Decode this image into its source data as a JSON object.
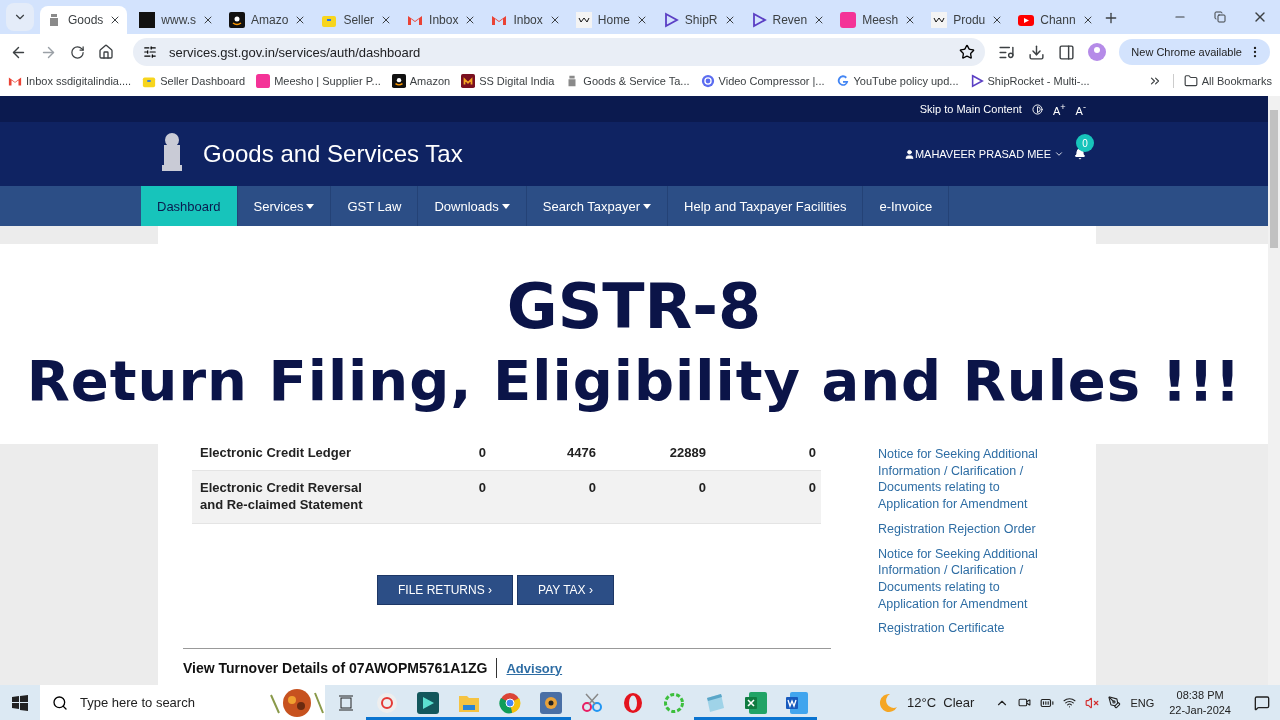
{
  "browser": {
    "tabs": [
      {
        "title": "Goods",
        "kind": "emblem",
        "selected": true
      },
      {
        "title": "www.s",
        "kind": "ss",
        "selected": false
      },
      {
        "title": "Amazo",
        "kind": "amazon",
        "selected": false
      },
      {
        "title": "Seller",
        "kind": "flipkart",
        "selected": false
      },
      {
        "title": "Inbox",
        "kind": "gmail",
        "selected": false
      },
      {
        "title": "Inbox",
        "kind": "gmail",
        "selected": false
      },
      {
        "title": "Home",
        "kind": "wix",
        "selected": false
      },
      {
        "title": "ShipR",
        "kind": "shiprocket",
        "selected": false
      },
      {
        "title": "Reven",
        "kind": "shiprocket",
        "selected": false
      },
      {
        "title": "Meesh",
        "kind": "meesho",
        "selected": false
      },
      {
        "title": "Produ",
        "kind": "wix",
        "selected": false
      },
      {
        "title": "Chann",
        "kind": "youtube",
        "selected": false
      }
    ],
    "url": "services.gst.gov.in/services/auth/dashboard",
    "update_button": "New Chrome available",
    "bookmarks": [
      {
        "title": "Inbox ssdigitalindia....",
        "kind": "gmail"
      },
      {
        "title": "Seller Dashboard",
        "kind": "flipkart"
      },
      {
        "title": "Meesho | Supplier P...",
        "kind": "meesho"
      },
      {
        "title": "Amazon",
        "kind": "amazon"
      },
      {
        "title": "SS Digital India",
        "kind": "ssd"
      },
      {
        "title": "Goods & Service Ta...",
        "kind": "emblem"
      },
      {
        "title": "Video Compressor |...",
        "kind": "compress"
      },
      {
        "title": "YouTube policy upd...",
        "kind": "google"
      },
      {
        "title": "ShipRocket - Multi-...",
        "kind": "shiprocket"
      }
    ],
    "all_bookmarks": "All Bookmarks"
  },
  "site": {
    "skip_link": "Skip to Main Content",
    "font_up": "A",
    "font_up_sign": "+",
    "font_down": "A",
    "font_down_sign": "-",
    "title": "Goods and Services Tax",
    "user": "MAHAVEER PRASAD MEE",
    "notifications": "0",
    "nav": [
      {
        "label": "Dashboard",
        "dropdown": false,
        "selected": true
      },
      {
        "label": "Services",
        "dropdown": true,
        "selected": false
      },
      {
        "label": "GST Law",
        "dropdown": false,
        "selected": false
      },
      {
        "label": "Downloads",
        "dropdown": true,
        "selected": false
      },
      {
        "label": "Search Taxpayer",
        "dropdown": true,
        "selected": false
      },
      {
        "label": "Help and Taxpayer Facilities",
        "dropdown": false,
        "selected": false
      },
      {
        "label": "e-Invoice",
        "dropdown": false,
        "selected": false
      }
    ],
    "ledger_rows": [
      {
        "label": "Electronic Credit Ledger",
        "values": [
          "0",
          "4476",
          "22889",
          "0"
        ]
      },
      {
        "label": "Electronic Credit Reversal and Re-claimed Statement",
        "values": [
          "0",
          "0",
          "0",
          "0"
        ]
      }
    ],
    "buttons": [
      "FILE RETURNS ›",
      "PAY TAX ›"
    ],
    "turnover": "View Turnover Details of 07AWOPM5761A1ZG",
    "advisory": "Advisory",
    "notices": [
      "Notice for Seeking Additional Information / Clarification / Documents relating to Application for Amendment",
      "Registration Rejection Order",
      "Notice for Seeking Additional Information / Clarification / Documents relating to Application for Amendment",
      "Registration Certificate"
    ]
  },
  "overlay": {
    "title": "GSTR-8",
    "subtitle": "Return Filing, Eligibility and Rules !!!"
  },
  "taskbar": {
    "search_placeholder": "Type here to search",
    "apps": [
      {
        "kind": "a",
        "running": true
      },
      {
        "kind": "media",
        "running": true
      },
      {
        "kind": "folder",
        "running": true
      },
      {
        "kind": "chrome",
        "running": true
      },
      {
        "kind": "audio",
        "running": true
      },
      {
        "kind": "snip",
        "running": false
      },
      {
        "kind": "opera",
        "running": false
      },
      {
        "kind": "ring",
        "running": false
      },
      {
        "kind": "notepad",
        "running": true
      },
      {
        "kind": "excel",
        "running": true
      },
      {
        "kind": "word",
        "running": true
      }
    ],
    "weather": "12°C  Clear",
    "language": "ENG",
    "time": "08:38 PM",
    "date": "22-Jan-2024"
  }
}
